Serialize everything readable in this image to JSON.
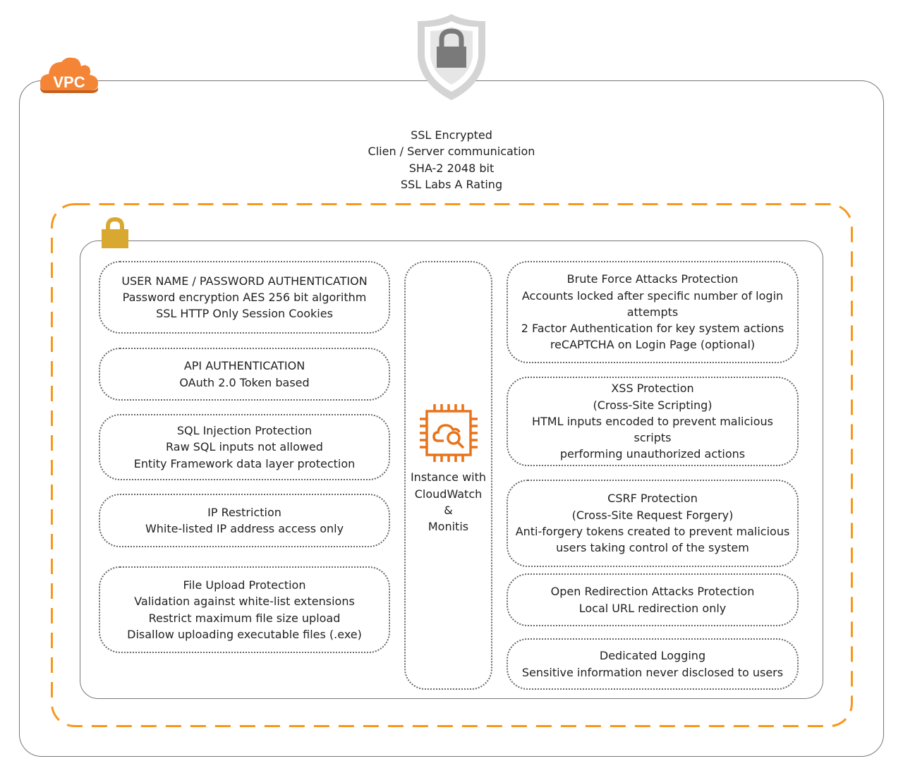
{
  "vpc": {
    "label": "VPC",
    "color": "#f58536"
  },
  "ssl": {
    "lines": [
      "SSL Encrypted",
      "Clien / Server communication",
      "SHA-2 2048 bit",
      "SSL Labs A Rating"
    ],
    "icon": "shield-lock-icon"
  },
  "colors": {
    "dashed_border": "#f7981d",
    "lock": "#d9a831",
    "chip": "#e8731a",
    "border": "#777777"
  },
  "left_boxes": [
    {
      "lines": [
        "USER NAME / PASSWORD AUTHENTICATION",
        "Password encryption AES 256 bit algorithm",
        "SSL HTTP Only Session Cookies"
      ]
    },
    {
      "lines": [
        "API AUTHENTICATION",
        "OAuth 2.0 Token based"
      ]
    },
    {
      "lines": [
        "SQL Injection Protection",
        "Raw SQL inputs not allowed",
        "Entity Framework data layer protection"
      ]
    },
    {
      "lines": [
        "IP Restriction",
        "White-listed IP address access only"
      ]
    },
    {
      "lines": [
        "File Upload Protection",
        "Validation against white-list extensions",
        "Restrict maximum file size upload",
        "Disallow uploading executable files (.exe)"
      ]
    }
  ],
  "center": {
    "lines": [
      "Instance with",
      "CloudWatch",
      "&",
      "Monitis"
    ],
    "icon": "instance-cloudwatch-icon"
  },
  "right_boxes": [
    {
      "lines": [
        "Brute Force Attacks Protection",
        "Accounts locked after specific number of login",
        "attempts",
        "2 Factor Authentication for key system actions",
        "reCAPTCHA on Login Page (optional)"
      ]
    },
    {
      "lines": [
        "XSS Protection",
        "(Cross-Site Scripting)",
        "HTML inputs encoded to prevent malicious scripts",
        "performing unauthorized actions"
      ]
    },
    {
      "lines": [
        "CSRF Protection",
        "(Cross-Site Request Forgery)",
        "Anti-forgery tokens created to prevent malicious",
        "users taking control of the system"
      ]
    },
    {
      "lines": [
        "Open Redirection Attacks Protection",
        "Local URL redirection only"
      ]
    },
    {
      "lines": [
        "Dedicated Logging",
        "Sensitive information never disclosed to users"
      ]
    }
  ]
}
